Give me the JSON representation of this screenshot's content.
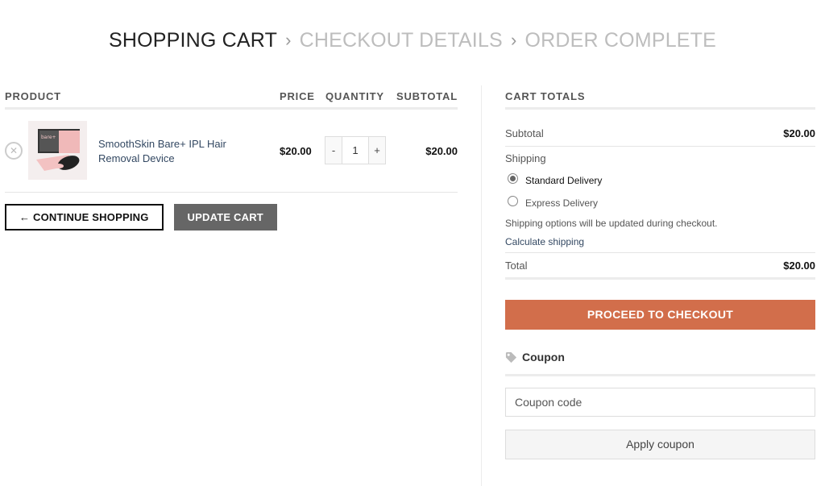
{
  "steps": {
    "cart": "SHOPPING CART",
    "separator": "›",
    "checkout": "CHECKOUT DETAILS",
    "complete": "ORDER COMPLETE"
  },
  "table": {
    "headers": {
      "product": "PRODUCT",
      "price": "PRICE",
      "quantity": "QUANTITY",
      "subtotal": "SUBTOTAL"
    },
    "items": [
      {
        "remove_icon": "close-circle-icon",
        "name": "SmoothSkin Bare+ IPL Hair Removal Device",
        "price": "$20.00",
        "quantity": "1",
        "minus": "-",
        "plus": "+",
        "subtotal": "$20.00"
      }
    ]
  },
  "actions": {
    "continue_label": "← CONTINUE SHOPPING",
    "update_label": "UPDATE CART"
  },
  "totals": {
    "heading": "CART TOTALS",
    "subtotal_label": "Subtotal",
    "subtotal_value": "$20.00",
    "shipping_label": "Shipping",
    "options": [
      {
        "label": "Standard Delivery",
        "selected": true
      },
      {
        "label": "Express Delivery",
        "selected": false
      }
    ],
    "shipping_note": "Shipping options will be updated during checkout.",
    "calculate_shipping": "Calculate shipping",
    "total_label": "Total",
    "total_value": "$20.00",
    "checkout_label": "PROCEED TO CHECKOUT"
  },
  "coupon": {
    "icon": "tag-icon",
    "heading": "Coupon",
    "placeholder": "Coupon code",
    "apply_label": "Apply coupon"
  },
  "colors": {
    "accent": "#d26e4b",
    "link": "#334862",
    "button_dark": "#666666"
  }
}
